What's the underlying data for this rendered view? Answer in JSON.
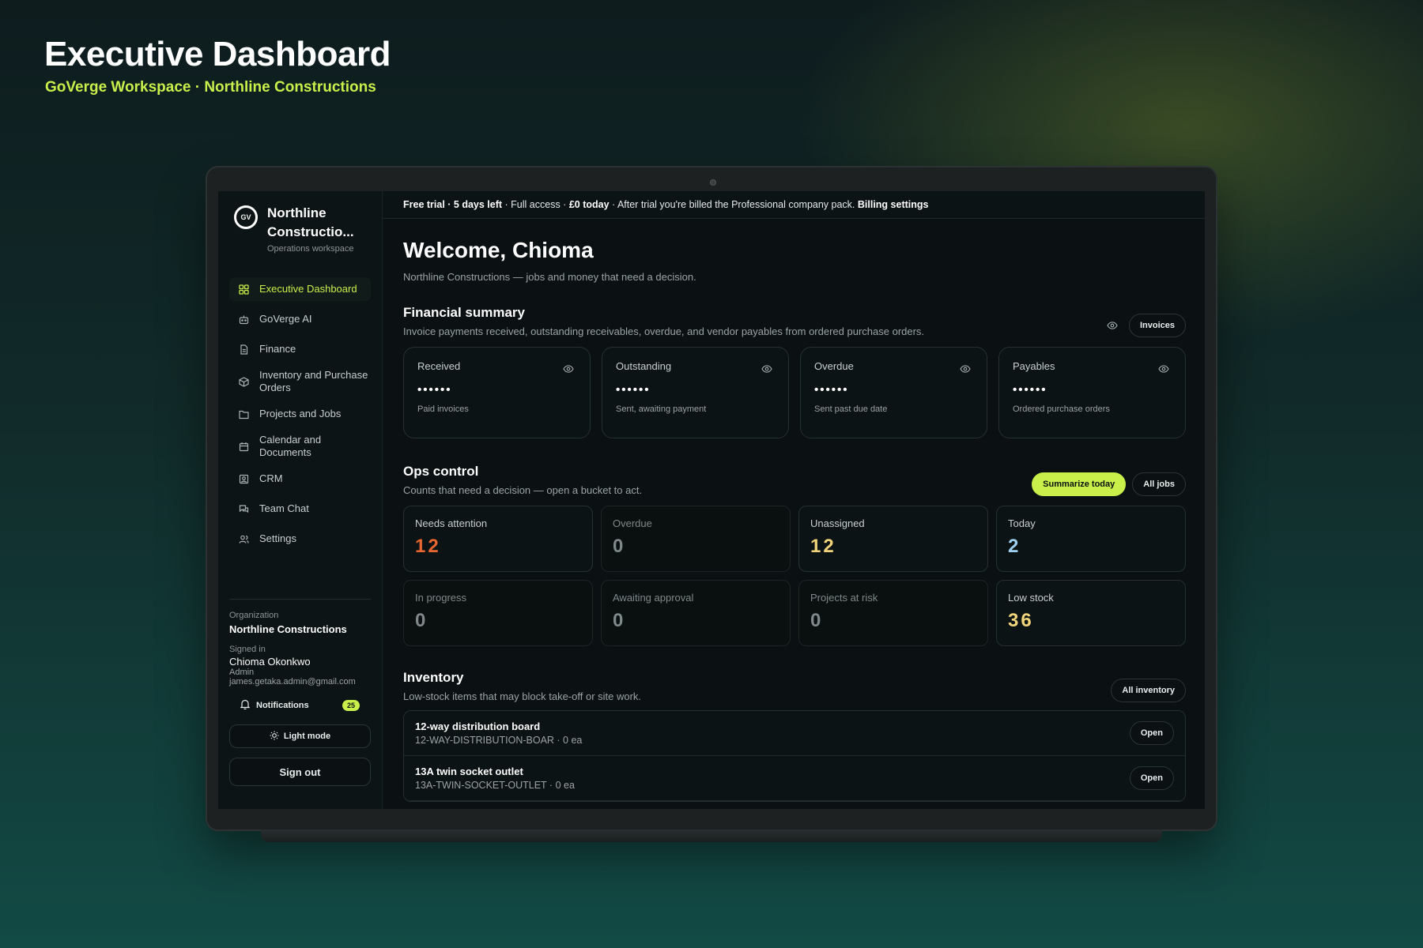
{
  "header": {
    "title": "Executive Dashboard",
    "subtitle": "GoVerge Workspace · Northline Constructions"
  },
  "colors": {
    "accent": "#c9ef4a",
    "needs_attention": "#e8662f",
    "unassigned": "#f1d37a",
    "today": "#9fd0f2",
    "low_stock": "#f1d37a",
    "zero": "#7f898a"
  },
  "sidebar": {
    "logo_text": "GV",
    "company_name": "Northline Constructio...",
    "workspace": "Operations workspace",
    "items": [
      {
        "label": "Executive Dashboard",
        "icon": "grid-icon"
      },
      {
        "label": "GoVerge AI",
        "icon": "robot-icon"
      },
      {
        "label": "Finance",
        "icon": "document-icon"
      },
      {
        "label": "Inventory and Purchase Orders",
        "icon": "box-icon"
      },
      {
        "label": "Projects and Jobs",
        "icon": "folder-icon"
      },
      {
        "label": "Calendar and Documents",
        "icon": "calendar-icon"
      },
      {
        "label": "CRM",
        "icon": "contact-icon"
      },
      {
        "label": "Team Chat",
        "icon": "chat-icon"
      },
      {
        "label": "Settings",
        "icon": "users-icon"
      }
    ],
    "organization_label": "Organization",
    "organization_name": "Northline Constructions",
    "signed_in_label": "Signed in",
    "user_name": "Chioma Okonkwo",
    "user_role": "Admin",
    "user_email": "james.getaka.admin@gmail.com",
    "notifications_label": "Notifications",
    "notifications_count": "25",
    "light_mode_label": "Light mode",
    "sign_out_label": "Sign out"
  },
  "trial_bar": {
    "trial": "Free trial · 5 days left",
    "details": " · Full access · ",
    "today": "£0 today",
    "after": " · After trial you're billed the Professional company pack. ",
    "billing_link": "Billing settings"
  },
  "welcome": {
    "title": "Welcome, Chioma",
    "subtitle": "Northline Constructions — jobs and money that need a decision."
  },
  "financial": {
    "title": "Financial summary",
    "description": "Invoice payments received, outstanding receivables, overdue, and vendor payables from ordered purchase orders.",
    "button": "Invoices",
    "cards": [
      {
        "title": "Received",
        "value": "••••••",
        "sub": "Paid invoices"
      },
      {
        "title": "Outstanding",
        "value": "••••••",
        "sub": "Sent, awaiting payment"
      },
      {
        "title": "Overdue",
        "value": "••••••",
        "sub": "Sent past due date"
      },
      {
        "title": "Payables",
        "value": "••••••",
        "sub": "Ordered purchase orders"
      }
    ]
  },
  "ops": {
    "title": "Ops control",
    "description": "Counts that need a decision — open a bucket to act.",
    "summarize_button": "Summarize today",
    "all_jobs_button": "All jobs",
    "cards": [
      {
        "label": "Needs attention",
        "value": "12"
      },
      {
        "label": "Overdue",
        "value": "0"
      },
      {
        "label": "Unassigned",
        "value": "12"
      },
      {
        "label": "Today",
        "value": "2"
      },
      {
        "label": "In progress",
        "value": "0"
      },
      {
        "label": "Awaiting approval",
        "value": "0"
      },
      {
        "label": "Projects at risk",
        "value": "0"
      },
      {
        "label": "Low stock",
        "value": "36"
      }
    ]
  },
  "inventory": {
    "title": "Inventory",
    "description": "Low-stock items that may block take-off or site work.",
    "button": "All inventory",
    "items": [
      {
        "name": "12-way distribution board",
        "code": "12-WAY-DISTRIBUTION-BOAR · 0 ea",
        "action": "Open"
      },
      {
        "name": "13A twin socket outlet",
        "code": "13A-TWIN-SOCKET-OUTLET · 0 ea",
        "action": "Open"
      }
    ]
  }
}
